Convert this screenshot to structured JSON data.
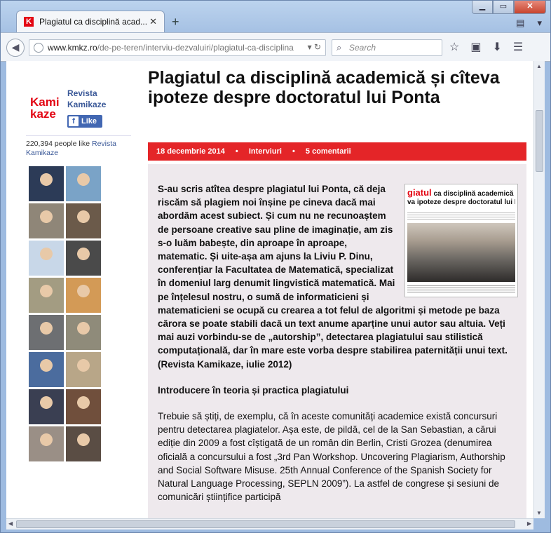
{
  "browser": {
    "tab_title": "Plagiatul ca disciplină acad...",
    "tab_favicon_letter": "K",
    "url_domain": "www.kmkz.ro",
    "url_path": "/de-pe-teren/interviu-dezvaluiri/plagiatul-ca-disciplina",
    "search_placeholder": "Search"
  },
  "sidebar": {
    "logo_line1": "Kami",
    "logo_line2": "kaze",
    "page_name": "Revista Kamikaze",
    "like_label": "Like",
    "likes_count": "220,394 people like",
    "likes_page": "Revista Kamikaze",
    "faces": [
      "#2c3b57",
      "#7aa3c7",
      "#8f8678",
      "#6b5a4a",
      "#c8d7e8",
      "#4a4a4a",
      "#a39c82",
      "#d39a56",
      "#6d6f72",
      "#8f8b7a",
      "#4b6c9e",
      "#b8a688",
      "#3a3f52",
      "#704f3c",
      "#9a8f86",
      "#5a4d44"
    ]
  },
  "article": {
    "title": "Plagiatul ca disciplină academică și cîteva ipoteze despre doctoratul lui Ponta",
    "date": "18 decembrie 2014",
    "category": "Interviuri",
    "comments": "5 comentarii",
    "lead": "S-au scris atîtea despre plagiatul lui Ponta, că deja riscăm să plagiem noi înșine pe cineva dacă mai abordăm acest subiect. Și cum nu ne recunoaștem de persoane creative sau pline de imaginație, am zis s-o luăm babește, din aproape în aproape, matematic. Și uite-așa am ajuns la Liviu P. Dinu, conferențiar la Facultatea de Matematică, specializat în domeniul larg denumit lingvistică matematică. Mai pe înțelesul nostru, o sumă de informaticieni și matematicieni se ocupă cu crearea a tot felul de algoritmi și metode pe baza cărora se poate stabili dacă un text anume aparține unui autor sau altuia. Veți mai auzi vorbindu-se de „autorship”, detectarea plagiatului sau stilistică computațională, dar în mare este vorba despre stabilirea paternității unui text. (Revista Kamikaze, iulie 2012)",
    "thumb_head_red": "giatul",
    "thumb_head_rest": " ca disciplină academică",
    "thumb_head_line2": "va ipoteze despre doctoratul lui Po",
    "subheading": "Introducere în teoria și practica plagiatului",
    "paragraph": "Trebuie să știți, de exemplu, că în aceste comunități academice există concursuri pentru detectarea plagiatelor. Așa este, de pildă, cel de la San Sebastian, a cărui ediție din 2009 a fost cîștigată de un român din Berlin, Cristi Grozea (denumirea oficială a concursului a fost „3rd Pan Workshop. Uncovering Plagiarism, Authorship and Social Software Misuse. 25th Annual Conference of the Spanish Society for Natural Language Processing, SEPLN 2009”). La astfel de congrese și sesiuni de comunicări științifice participă"
  },
  "colors": {
    "accent_red": "#e42528",
    "facebook_blue": "#4267b2",
    "body_bg": "#eee9ed"
  }
}
